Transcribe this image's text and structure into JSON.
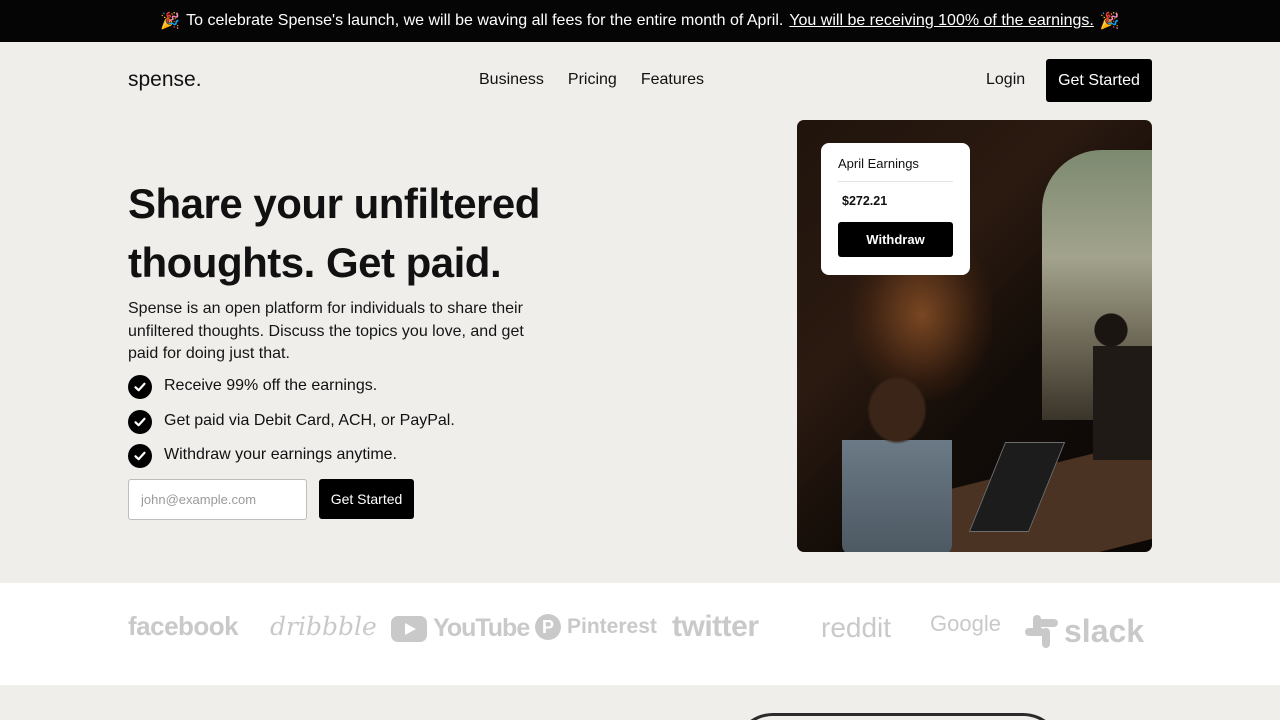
{
  "banner": {
    "prefix_emoji": "🎉",
    "text": "To celebrate Spense's launch, we will be waving all fees for the entire month of April.",
    "link_text": "You will be receiving 100% of the earnings.",
    "suffix_emoji": "🎉"
  },
  "nav": {
    "logo": "spense.",
    "links": [
      "Business",
      "Pricing",
      "Features"
    ],
    "login": "Login",
    "cta": "Get Started"
  },
  "hero": {
    "title": "Share your unfiltered thoughts. Get paid.",
    "description": "Spense is an open platform for individuals to share their unfiltered thoughts. Discuss the topics you love, and get paid for doing just that.",
    "features": [
      "Receive 99% off the earnings.",
      "Get paid via Debit Card, ACH, or PayPal.",
      "Withdraw your earnings anytime."
    ],
    "email_placeholder": "john@example.com",
    "cta": "Get Started"
  },
  "earnings_card": {
    "title": "April Earnings",
    "amount": "$272.21",
    "button": "Withdraw"
  },
  "logos": [
    "facebook",
    "dribbble",
    "YouTube",
    "Pinterest",
    "twitter",
    "reddit",
    "Google",
    "slack"
  ],
  "colors": {
    "background": "#efeeeb",
    "primary": "#000000",
    "logo_gray": "#c9c9c9"
  }
}
